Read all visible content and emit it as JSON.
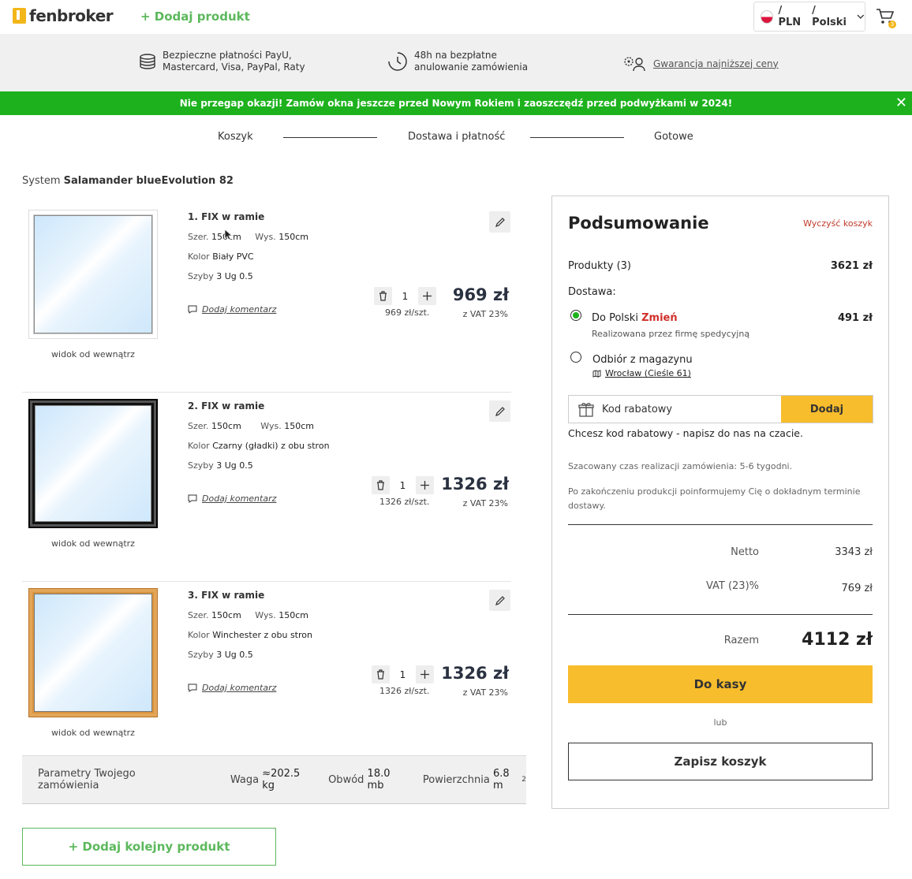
{
  "header": {
    "logo_text": "fenbroker",
    "add_product": "+ Dodaj produkt",
    "currency": "/ PLN",
    "language": "/ Polski",
    "cart_count": "3"
  },
  "benefits": [
    {
      "icon": "coins-icon",
      "line1": "Bezpieczne płatności PayU,",
      "line2": "Mastercard, Visa, PayPal, Raty"
    },
    {
      "icon": "clock-icon",
      "line1": "48h na bezpłatne",
      "line2": "anulowanie zamówienia"
    },
    {
      "icon": "guarantee-icon",
      "link": "Gwarancja najniższej ceny"
    }
  ],
  "promo": {
    "text": "Nie przegap okazji! Zamów okna jeszcze przed Nowym Rokiem i zaoszczędź przed podwyżkami w 2024!",
    "close": "✕"
  },
  "steps": [
    "Koszyk",
    "Dostawa i płatność",
    "Gotowe"
  ],
  "system": {
    "prefix": "System",
    "name": "Salamander blueEvolution 82"
  },
  "products": [
    {
      "title": "1. FIX w ramie",
      "width_label": "Szer.",
      "width": "150cm",
      "height_label": "Wys.",
      "height": "150cm",
      "color_label": "Kolor",
      "color": "Biały PVC",
      "glass_label": "Szyby",
      "glass": "3 Ug 0.5",
      "comment": "Dodaj komentarz",
      "view": "widok od wewnątrz",
      "qty": "1",
      "unit_price": "969 zł/szt.",
      "price": "969 zł",
      "vat": "z VAT 23%",
      "frame_color": "#ffffff"
    },
    {
      "title": "2. FIX w ramie",
      "width_label": "Szer.",
      "width": "150cm",
      "height_label": "Wys.",
      "height": "150cm",
      "color_label": "Kolor",
      "color": "Czarny (gładki) z obu stron",
      "glass_label": "Szyby",
      "glass": "3 Ug 0.5",
      "comment": "Dodaj komentarz",
      "view": "widok od wewnątrz",
      "qty": "1",
      "unit_price": "1326 zł/szt.",
      "price": "1326 zł",
      "vat": "z VAT 23%",
      "frame_color": "#111111"
    },
    {
      "title": "3. FIX w ramie",
      "width_label": "Szer.",
      "width": "150cm",
      "height_label": "Wys.",
      "height": "150cm",
      "color_label": "Kolor",
      "color": "Winchester z obu stron",
      "glass_label": "Szyby",
      "glass": "3 Ug 0.5",
      "comment": "Dodaj komentarz",
      "view": "widok od wewnątrz",
      "qty": "1",
      "unit_price": "1326 zł/szt.",
      "price": "1326 zł",
      "vat": "z VAT 23%",
      "frame_color": "#d9943f"
    }
  ],
  "params": {
    "label": "Parametry Twojego zamówienia",
    "weight_label": "Waga",
    "weight": "≈202.5 kg",
    "perimeter_label": "Obwód",
    "perimeter": "18.0 mb",
    "area_label": "Powierzchnia",
    "area": "6.8 m",
    "area_sup": "2"
  },
  "add_more": "+ Dodaj kolejny produkt",
  "summary": {
    "title": "Podsumowanie",
    "clear": "Wyczyść koszyk",
    "products_label": "Produkty (3)",
    "products_value": "3621 zł",
    "delivery_label": "Dostawa:",
    "opt1_label": "Do Polski",
    "opt1_change": "Zmień",
    "opt1_value": "491 zł",
    "opt1_sub": "Realizowana przez firmę spedycyjną",
    "opt2_label": "Odbiór z magazynu",
    "opt2_addr": "Wrocław (Cieśle 61)",
    "coupon_placeholder": "Kod rabatowy",
    "coupon_button": "Dodaj",
    "coupon_hint": "Chcesz kod rabatowy - napisz do nas na czacie.",
    "eta": "Szacowany czas realizacji zamówienia: 5-6 tygodni.",
    "notice": "Po zakończeniu produkcji poinformujemy Cię o dokładnym terminie dostawy.",
    "net_label": "Netto",
    "net_value": "3343 zł",
    "vat_label": "VAT (23)%",
    "vat_value": "769 zł",
    "total_label": "Razem",
    "total_value": "4112 zł",
    "checkout": "Do kasy",
    "or": "lub",
    "save": "Zapisz koszyk"
  },
  "colors": {
    "green": "#1db21d",
    "accent": "#f8bd2c",
    "link_green": "#5cb85c",
    "change_red": "#d0302a"
  }
}
